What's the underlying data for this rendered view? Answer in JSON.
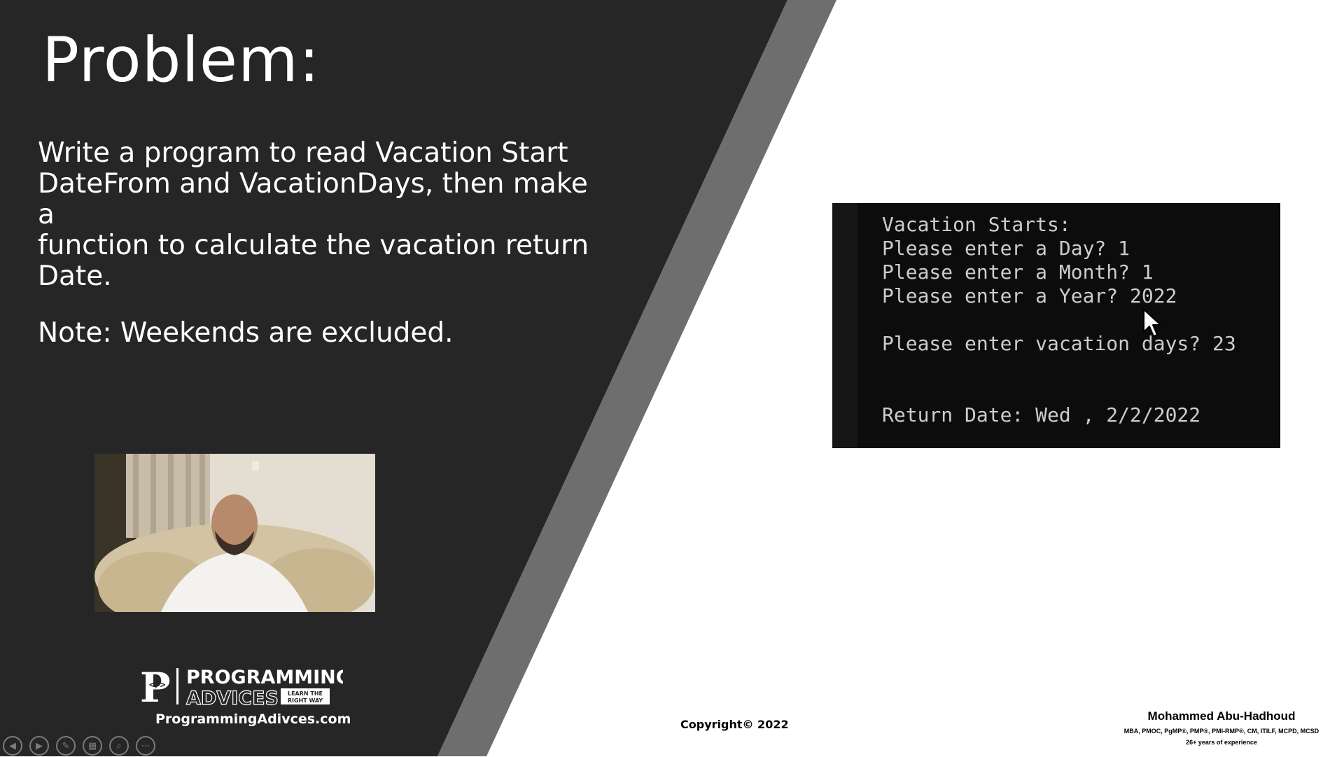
{
  "colors": {
    "dark_panel": "#262626",
    "stripe": "#6e6e6e",
    "console_bg": "#0c0c0c",
    "console_text": "#cccccc"
  },
  "slide": {
    "title": "Problem:",
    "problem_lines": [
      "Write a program to read Vacation Start",
      "DateFrom and VacationDays, then make a",
      "function to calculate the vacation return",
      "Date."
    ],
    "note": "Note: Weekends are excluded."
  },
  "console": {
    "lines": [
      "Vacation Starts:",
      "Please enter a Day? 1",
      "Please enter a Month? 1",
      "Please enter a Year? 2022",
      "",
      "Please enter vacation days? 23",
      "",
      "",
      "Return Date: Wed , 2/2/2022"
    ]
  },
  "branding": {
    "logo_word1": "PROGRAMMING",
    "logo_word2": "ADVICES",
    "logo_tagline": "LEARN THE RIGHT WAY",
    "url": "ProgrammingAdivces.com"
  },
  "footer": {
    "copyright": "Copyright© 2022",
    "author_name": "Mohammed Abu-Hadhoud",
    "author_credentials": "MBA, PMOC, PgMP®, PMP®, PMI-RMP®, CM, ITILF, MCPD, MCSD",
    "author_experience": "26+ years of experience"
  },
  "controls": [
    {
      "icon": "previous-icon",
      "glyph": "◀"
    },
    {
      "icon": "next-icon",
      "glyph": "▶"
    },
    {
      "icon": "pen-icon",
      "glyph": "✎"
    },
    {
      "icon": "slides-grid-icon",
      "glyph": "▦"
    },
    {
      "icon": "zoom-icon",
      "glyph": "⌕"
    },
    {
      "icon": "more-options-icon",
      "glyph": "⋯"
    }
  ]
}
